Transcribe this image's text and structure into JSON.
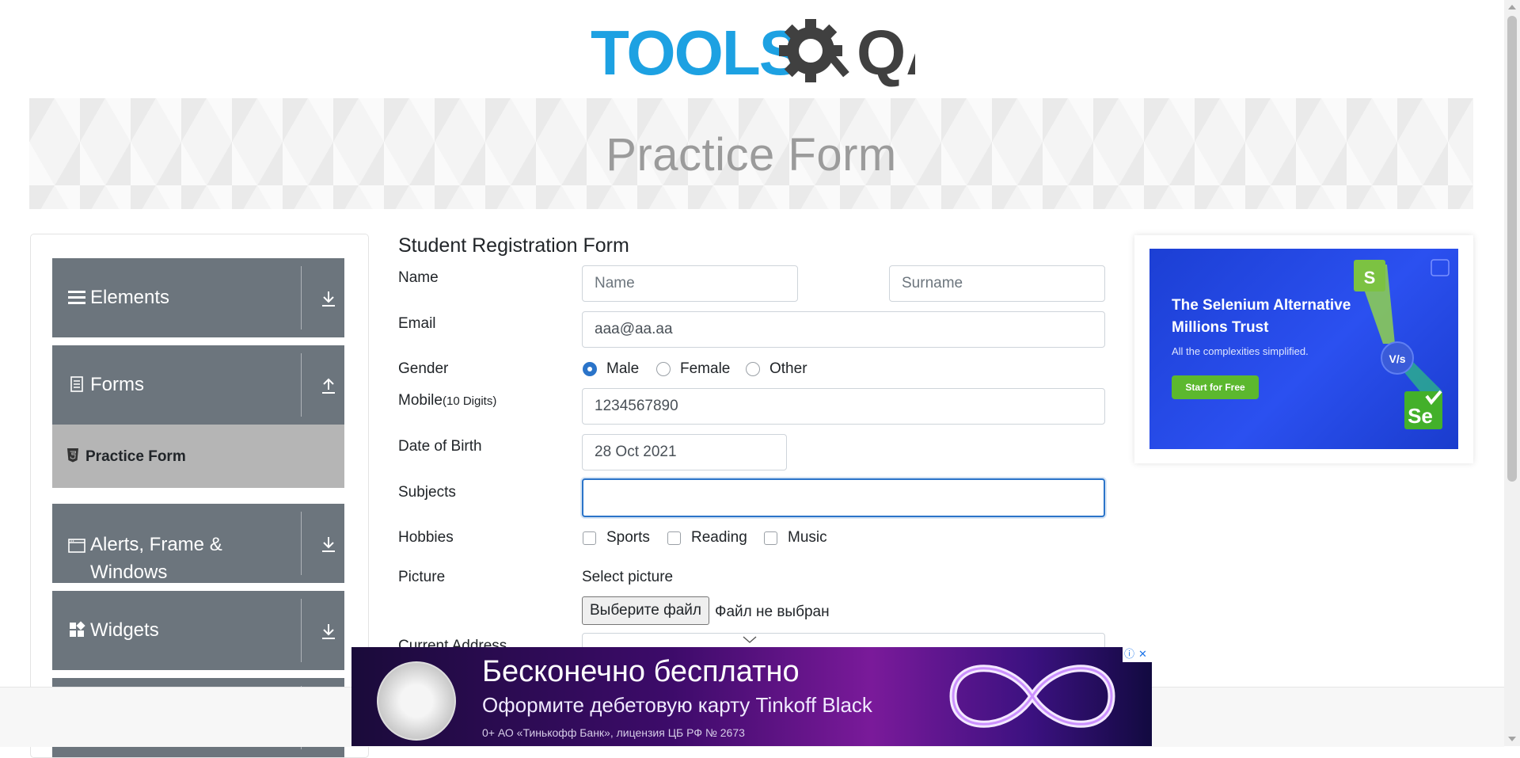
{
  "logo": {
    "text_tools": "TOOLS",
    "text_qa": "QA"
  },
  "banner": {
    "title": "Practice Form"
  },
  "sidebar": {
    "groups": [
      {
        "label": "Elements",
        "icon": "menu-icon",
        "arrow": "download-arrow-icon"
      },
      {
        "label": "Forms",
        "icon": "document-icon",
        "arrow": "upload-arrow-icon"
      },
      {
        "label": "Alerts, Frame & Windows",
        "icon": "window-icon",
        "arrow": "download-arrow-icon"
      },
      {
        "label": "Widgets",
        "icon": "widgets-icon",
        "arrow": "download-arrow-icon"
      }
    ],
    "active_item": {
      "label": "Practice Form",
      "icon": "html5-icon"
    }
  },
  "form": {
    "title": "Student Registration Form",
    "labels": {
      "name": "Name",
      "email": "Email",
      "gender": "Gender",
      "mobile": "Mobile",
      "mobile_hint": "(10 Digits)",
      "dob": "Date of Birth",
      "subjects": "Subjects",
      "hobbies": "Hobbies",
      "picture": "Picture",
      "current_address": "Current Address"
    },
    "first_name": {
      "placeholder": "Name",
      "value": ""
    },
    "last_name": {
      "placeholder": "Surname",
      "value": ""
    },
    "email": {
      "value": "aaa@aa.aa"
    },
    "gender_options": [
      {
        "label": "Male",
        "checked": true
      },
      {
        "label": "Female",
        "checked": false
      },
      {
        "label": "Other",
        "checked": false
      }
    ],
    "mobile": {
      "value": "1234567890"
    },
    "dob": {
      "value": "28 Oct 2021"
    },
    "subjects": {
      "value": ""
    },
    "hobby_options": [
      {
        "label": "Sports",
        "checked": false
      },
      {
        "label": "Reading",
        "checked": false
      },
      {
        "label": "Music",
        "checked": false
      }
    ],
    "picture": {
      "select_text": "Select picture",
      "button": "Выберите файл",
      "status": "Файл не выбран"
    }
  },
  "right_ad": {
    "headline": "The Selenium Alternative Millions Trust",
    "sub": "All the complexities simplified.",
    "cta": "Start for Free",
    "vs": "V/s",
    "colors": {
      "bg": "#2b50f0",
      "cta": "#5cb82e"
    }
  },
  "bottom_ad": {
    "line1": "Бесконечно бесплатно",
    "line2": "Оформите дебетовую карту Tinkoff Black",
    "line3": "0+  АО «Тинькофф Банк», лицензия ЦБ РФ № 2673",
    "info": "ⓘ",
    "close": "✕"
  },
  "colors": {
    "accent": "#2b74c9",
    "nav_bg": "#6c757d",
    "nav_active": "#b5b5b5",
    "logo_blue": "#1da1e2",
    "logo_dark": "#404040"
  }
}
